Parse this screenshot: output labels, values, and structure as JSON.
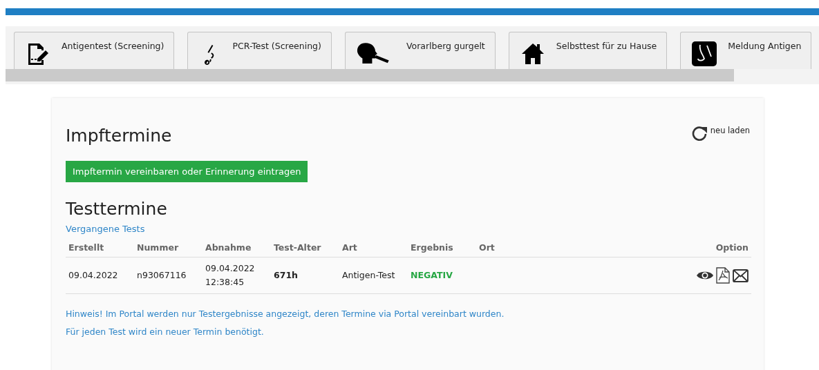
{
  "tabs": [
    {
      "label": "Antigentest (Screening)",
      "kind": "form"
    },
    {
      "label": "PCR-Test (Screening)",
      "kind": "swab"
    },
    {
      "label": "Vorarlberg gurgelt",
      "kind": "gargle"
    },
    {
      "label": "Selbsttest für zu Hause",
      "kind": "home"
    },
    {
      "label": "Meldung Antigen",
      "kind": "nose"
    }
  ],
  "reload": {
    "label": "neu laden"
  },
  "vaccination": {
    "title": "Impftermine",
    "button": "Impftermin vereinbaren oder Erinnerung eintragen"
  },
  "tests": {
    "title": "Testtermine",
    "past_link": "Vergangene Tests",
    "table": {
      "columns": [
        "Erstellt",
        "Nummer",
        "Abnahme",
        "Test-Alter",
        "Art",
        "Ergebnis",
        "Ort",
        "Option"
      ],
      "rows": [
        {
          "cells": [
            {
              "kind": "plain",
              "lines": [
                "09.04.2022"
              ]
            },
            {
              "kind": "plain",
              "lines": [
                "n93067116"
              ]
            },
            {
              "kind": "plain",
              "lines": [
                "09.04.2022",
                "12:38:45"
              ]
            },
            {
              "kind": "bold",
              "lines": [
                "671h"
              ]
            },
            {
              "kind": "plain",
              "lines": [
                "Antigen-Test"
              ]
            },
            {
              "kind": "result",
              "lines": [
                "NEGATIV"
              ]
            }
          ],
          "actions": [
            {
              "kind": "view"
            },
            {
              "kind": "pdf"
            },
            {
              "kind": "mail"
            }
          ]
        }
      ]
    },
    "notes": [
      "Hinweis! Im Portal werden nur Testergebnisse angezeigt, deren Termine via Portal vereinbart wurden.",
      "Für jeden Test wird ein neuer Termin benötigt."
    ]
  }
}
